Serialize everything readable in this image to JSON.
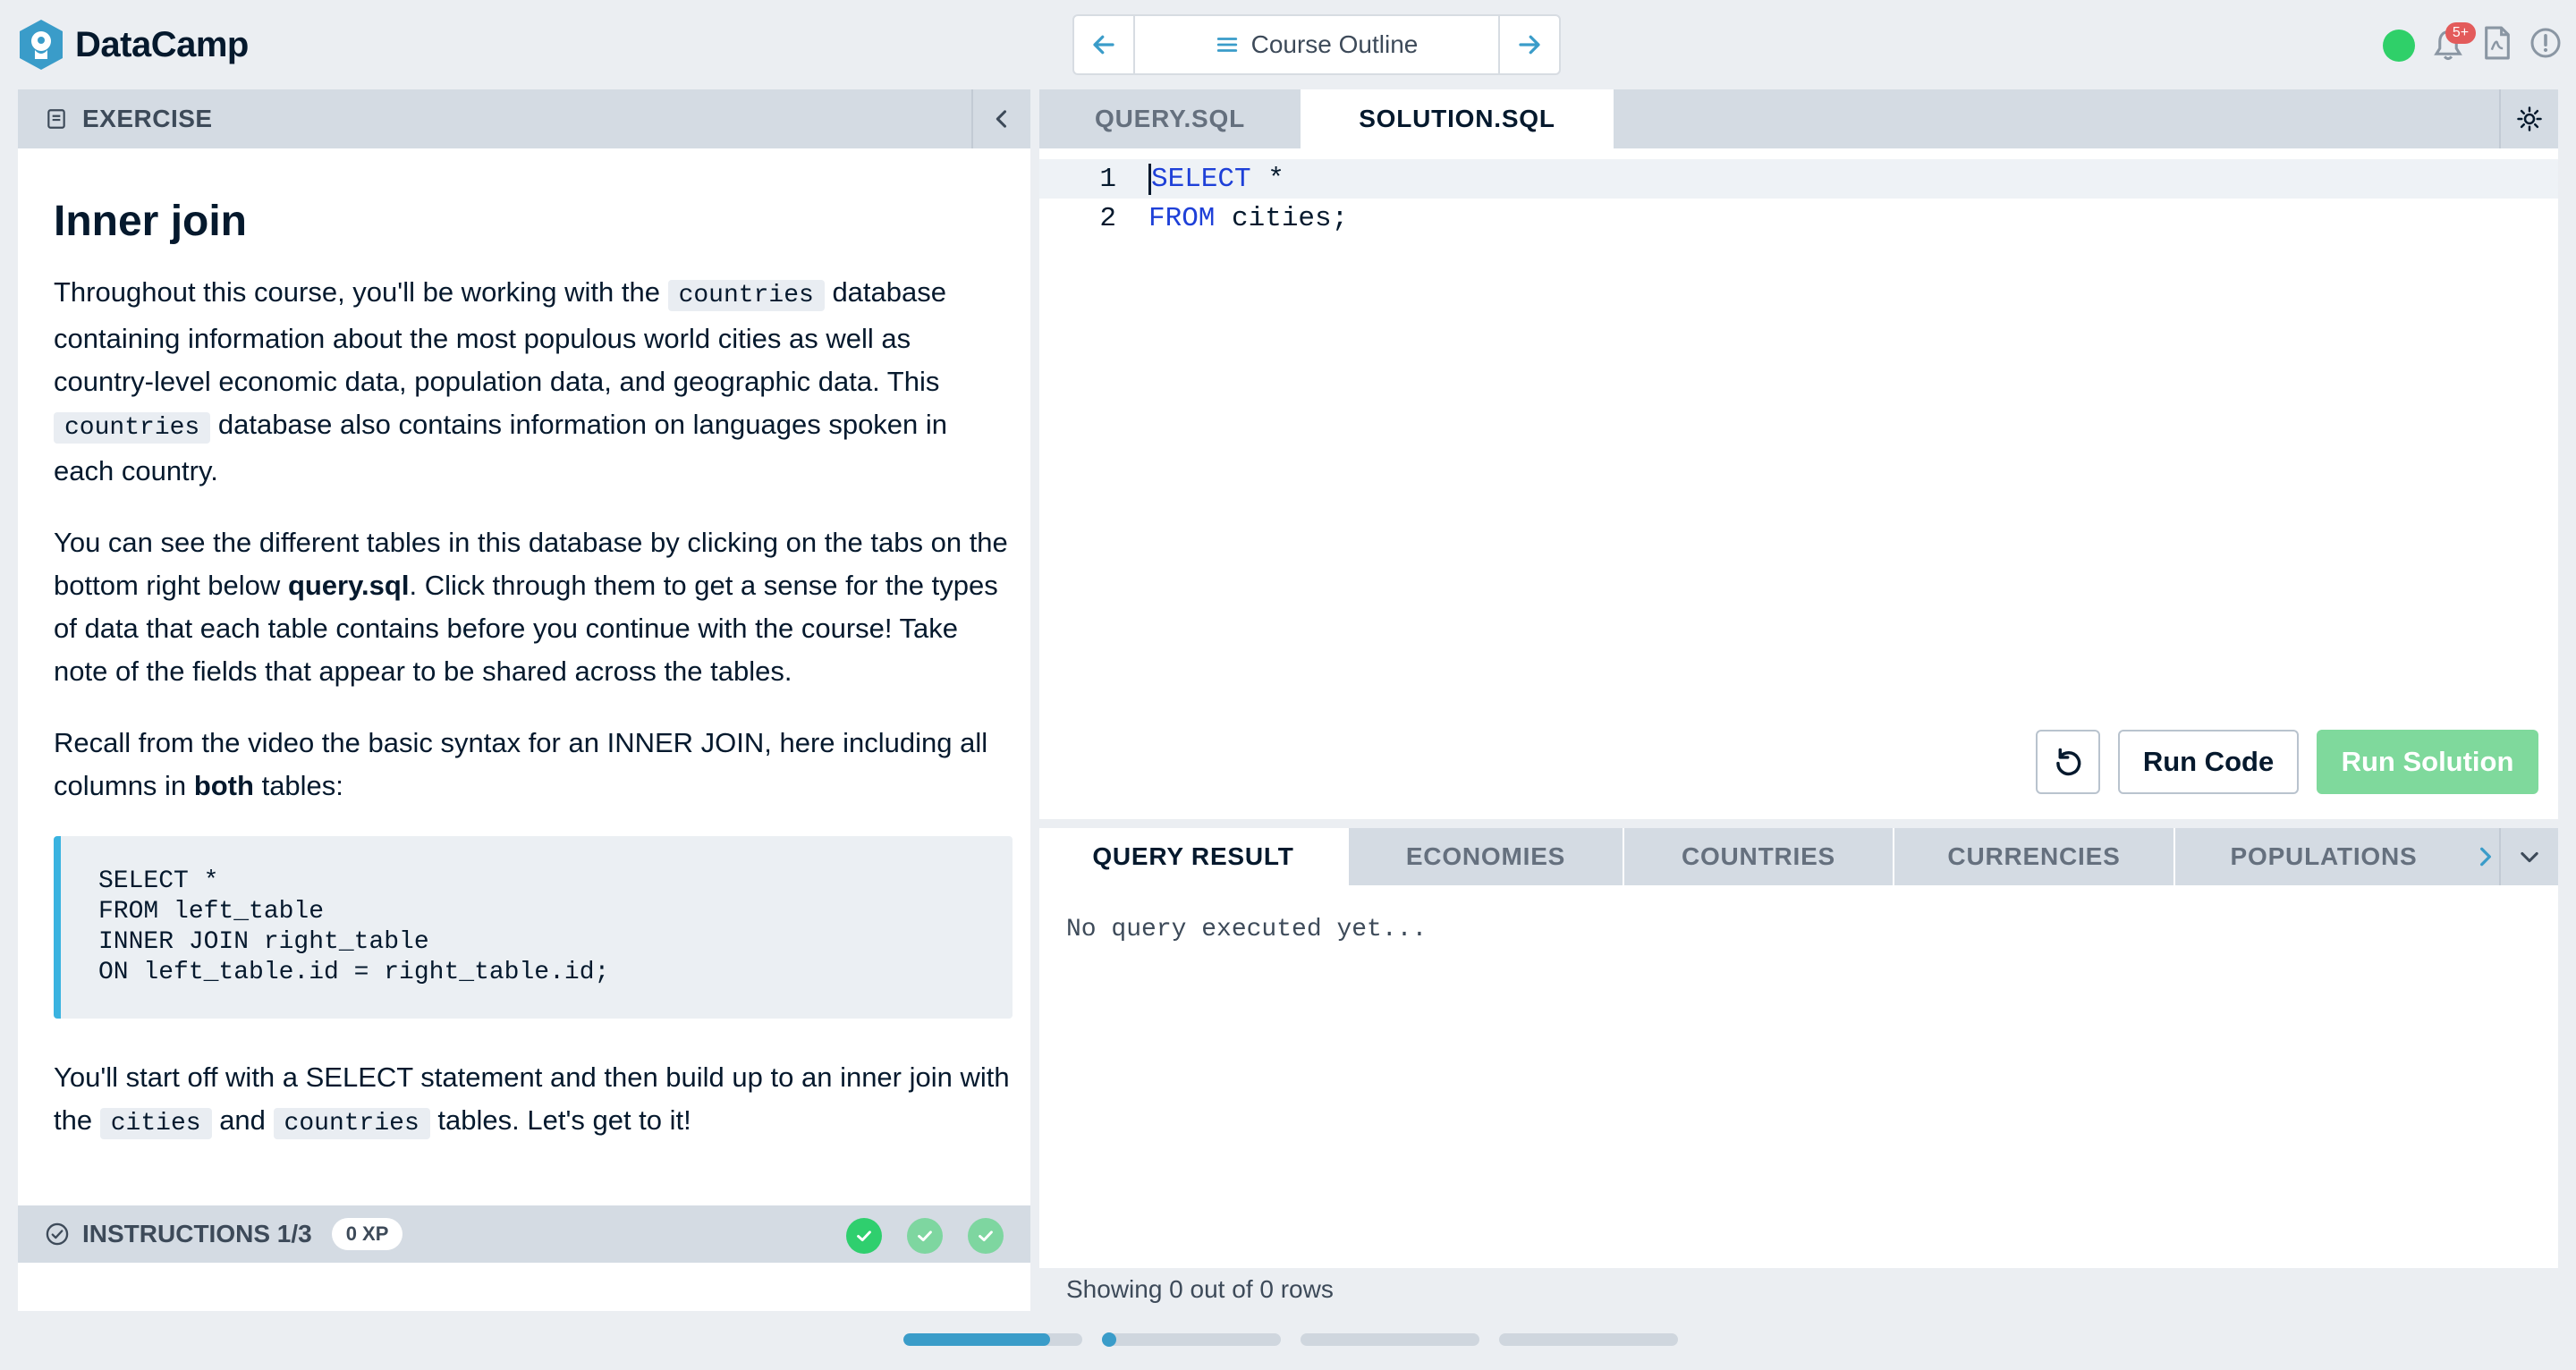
{
  "app": {
    "name": "DataCamp"
  },
  "nav": {
    "title": "Course Outline",
    "prev_icon": "arrow-left-icon",
    "next_icon": "arrow-right-icon"
  },
  "header_right": {
    "notification_badge": "5+"
  },
  "exercise": {
    "header": "EXERCISE",
    "title": "Inner join",
    "para1": {
      "t1": "Throughout this course, you'll be working with the",
      "c1": "countries",
      "t2": "database containing information about the most populous world cities as well as country-level economic data, population data, and geographic data. This",
      "c2": "countries",
      "t3": "database also contains information on languages spoken in each country."
    },
    "para2": {
      "t1": "You can see the different tables in this database by clicking on the tabs on the bottom right below",
      "b1": "query.sql",
      "t2": ". Click through them to get a sense for the types of data that each table contains before you continue with the course! Take note of the fields that appear to be shared across the tables."
    },
    "para3": {
      "t1": "Recall from the video the basic syntax for an INNER JOIN, here including all columns in",
      "b1": "both",
      "t2": "tables:"
    },
    "code_block": "SELECT *\nFROM left_table\nINNER JOIN right_table\nON left_table.id = right_table.id;",
    "para4": {
      "t1": "You'll start off with a SELECT statement and then build up to an inner join with the",
      "c1": "cities",
      "t2": "and",
      "c2": "countries",
      "t3": "tables. Let's get to it!"
    }
  },
  "instructions": {
    "label": "INSTRUCTIONS 1/3",
    "xp": "0 XP",
    "steps_total": 3
  },
  "editor": {
    "tabs": [
      "QUERY.SQL",
      "SOLUTION.SQL"
    ],
    "active_tab": "SOLUTION.SQL",
    "lines": [
      {
        "num": "1",
        "kw": "SELECT",
        "rest": " *"
      },
      {
        "num": "2",
        "kw": "FROM",
        "rest": " cities;"
      }
    ],
    "run_code": "Run Code",
    "run_solution": "Run Solution"
  },
  "results": {
    "tabs": [
      "QUERY RESULT",
      "ECONOMIES",
      "COUNTRIES",
      "CURRENCIES",
      "POPULATIONS"
    ],
    "active_tab": "QUERY RESULT",
    "message": "No query executed yet...",
    "footer": "Showing 0 out of 0 rows"
  },
  "progress": {
    "segments": [
      0.82,
      0.0,
      0.0,
      0.0
    ]
  },
  "colors": {
    "accent": "#3ab3e0",
    "success": "#2fd069",
    "keyword": "#1e40d8"
  }
}
